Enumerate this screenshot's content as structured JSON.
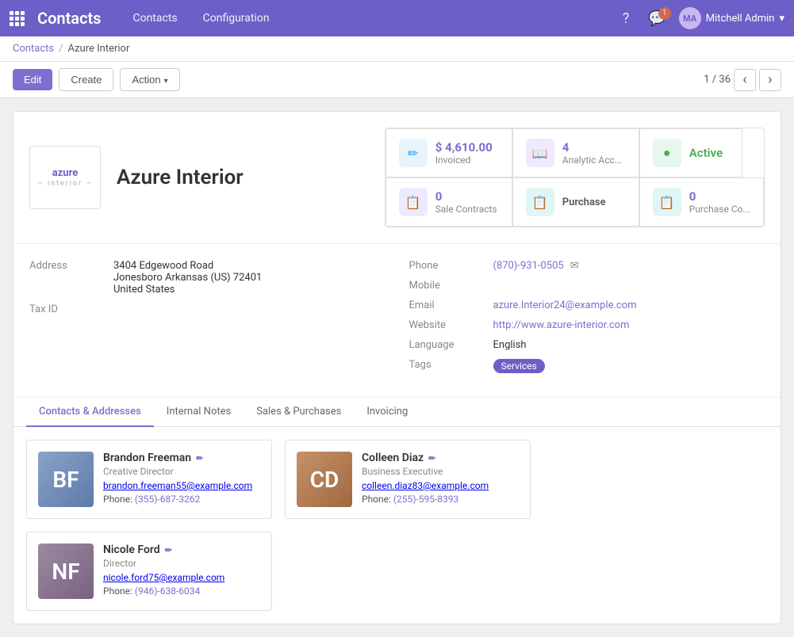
{
  "app": {
    "name": "Contacts",
    "nav_links": [
      "Contacts",
      "Configuration"
    ],
    "user": "Mitchell Admin"
  },
  "breadcrumb": {
    "parent": "Contacts",
    "current": "Azure Interior"
  },
  "toolbar": {
    "edit_label": "Edit",
    "create_label": "Create",
    "action_label": "Action",
    "pagination": "1 / 36"
  },
  "company": {
    "name": "Azure Interior",
    "logo_line1": "azure",
    "logo_line2": "— interior —"
  },
  "stats": [
    {
      "id": "invoiced",
      "icon": "pencil",
      "value": "$ 4,610.00",
      "label": "Invoiced",
      "color": "blue"
    },
    {
      "id": "analytic",
      "icon": "book",
      "value": "4",
      "label": "Analytic Acc...",
      "color": "purple"
    },
    {
      "id": "active",
      "icon": "green-dot",
      "value": "Active",
      "label": "",
      "color": "green"
    },
    {
      "id": "sale-contracts",
      "icon": "contract",
      "value": "0",
      "label": "Sale Contracts",
      "color": "purple"
    },
    {
      "id": "purchase",
      "icon": "contract2",
      "value": "Purchase",
      "label": "",
      "color": "teal"
    },
    {
      "id": "purchase-contracts",
      "icon": "contract3",
      "value": "0",
      "label": "Purchase Co...",
      "color": "teal"
    }
  ],
  "contact_details": {
    "address_label": "Address",
    "address_line1": "3404 Edgewood Road",
    "address_line2": "Jonesboro  Arkansas (US)  72401",
    "address_line3": "United States",
    "tax_id_label": "Tax ID",
    "phone_label": "Phone",
    "phone_value": "(870)-931-0505",
    "mobile_label": "Mobile",
    "email_label": "Email",
    "email_value": "azure.Interior24@example.com",
    "website_label": "Website",
    "website_value": "http://www.azure-interior.com",
    "language_label": "Language",
    "language_value": "English",
    "tags_label": "Tags",
    "tags": [
      "Services"
    ]
  },
  "tabs": [
    {
      "id": "contacts",
      "label": "Contacts & Addresses",
      "active": true
    },
    {
      "id": "internal-notes",
      "label": "Internal Notes",
      "active": false
    },
    {
      "id": "sales-purchases",
      "label": "Sales & Purchases",
      "active": false
    },
    {
      "id": "invoicing",
      "label": "Invoicing",
      "active": false
    }
  ],
  "contacts": [
    {
      "name": "Brandon Freeman",
      "role": "Creative Director",
      "email": "brandon.freeman55@example.com",
      "phone": "(355)-687-3262"
    },
    {
      "name": "Colleen Diaz",
      "role": "Business Executive",
      "email": "colleen.diaz83@example.com",
      "phone": "(255)-595-8393"
    },
    {
      "name": "Nicole Ford",
      "role": "Director",
      "email": "nicole.ford75@example.com",
      "phone": "(946)-638-6034"
    }
  ]
}
